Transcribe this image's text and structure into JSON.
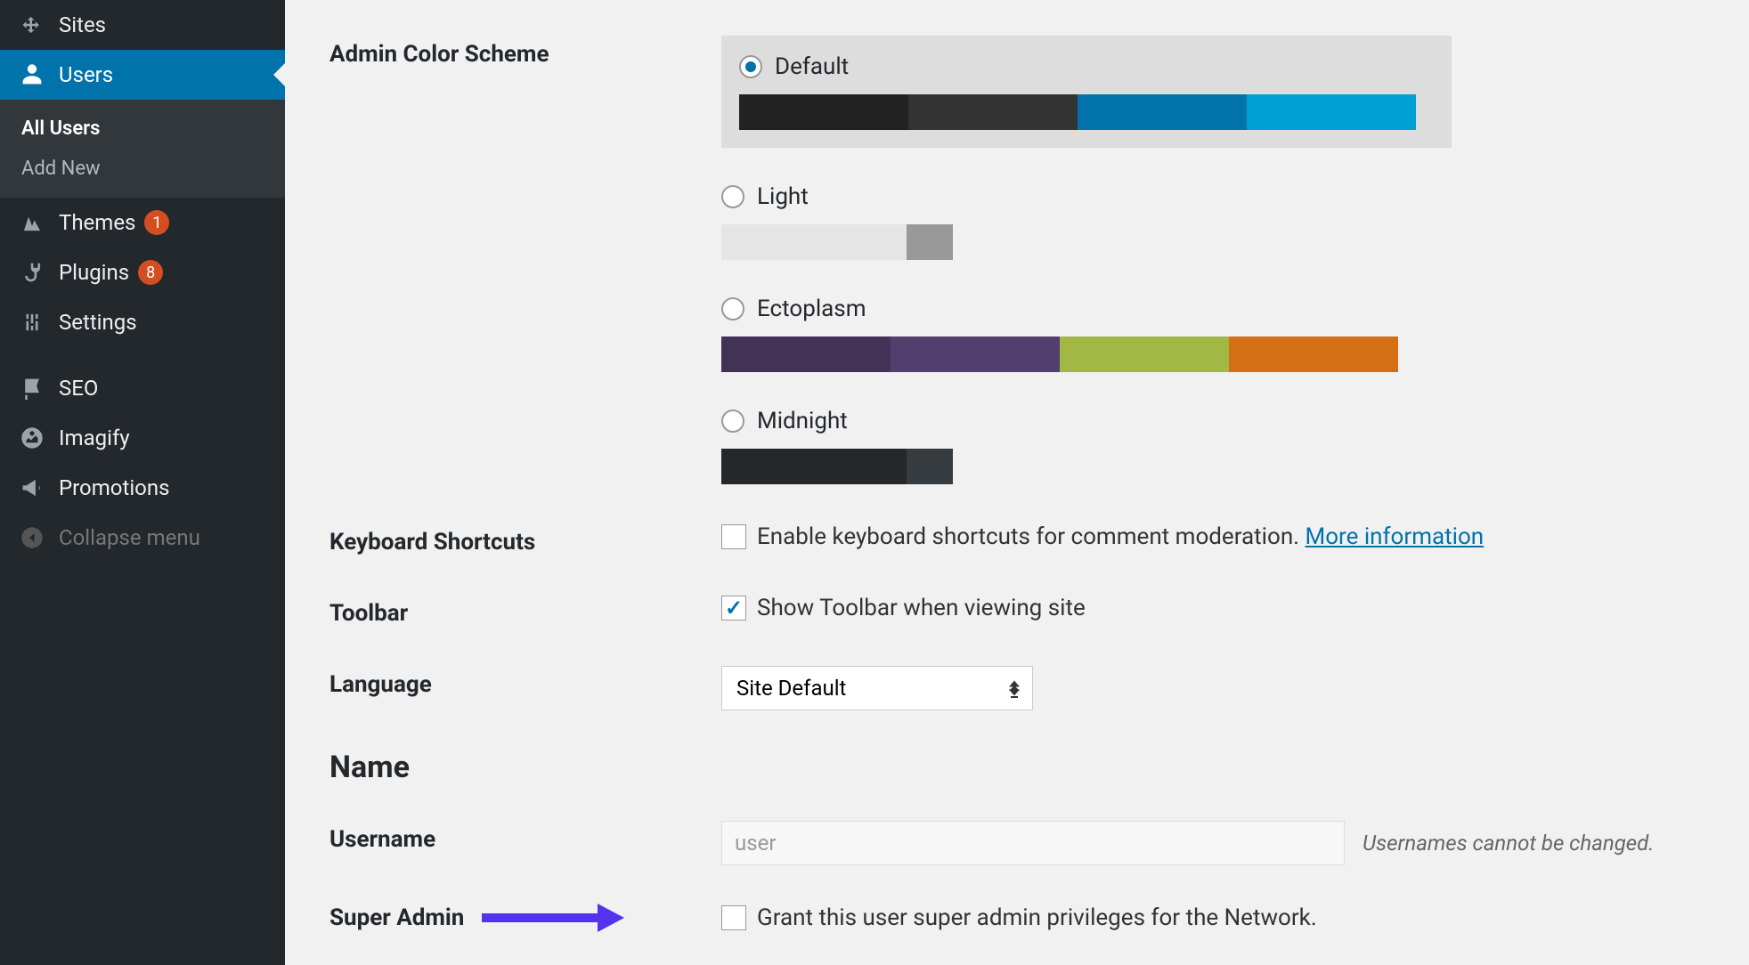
{
  "sidebar": {
    "items": [
      {
        "label": "Sites",
        "icon": "sites"
      },
      {
        "label": "Users",
        "icon": "users",
        "active": true
      },
      {
        "label": "Themes",
        "icon": "themes",
        "badge": "1"
      },
      {
        "label": "Plugins",
        "icon": "plugins",
        "badge": "8"
      },
      {
        "label": "Settings",
        "icon": "settings"
      },
      {
        "label": "SEO",
        "icon": "seo"
      },
      {
        "label": "Imagify",
        "icon": "imagify"
      },
      {
        "label": "Promotions",
        "icon": "promotions"
      },
      {
        "label": "Collapse menu",
        "icon": "collapse"
      }
    ],
    "submenu": [
      {
        "label": "All Users",
        "current": true
      },
      {
        "label": "Add New"
      }
    ]
  },
  "form": {
    "adminColorScheme": {
      "label": "Admin Color Scheme",
      "options": [
        {
          "name": "Default",
          "selected": true,
          "colors": [
            "#222",
            "#333",
            "#0073aa",
            "#00a0d2"
          ]
        },
        {
          "name": "Light",
          "colors": [
            "#e5e5e5",
            "#999",
            "#d64e07",
            "#04a4cc"
          ]
        },
        {
          "name": "Ectoplasm",
          "colors": [
            "#413256",
            "#523f6d",
            "#a3b745",
            "#d46f15"
          ]
        },
        {
          "name": "Midnight",
          "colors": [
            "#25282b",
            "#363b3f",
            "#69a8bb",
            "#e14d43"
          ]
        }
      ]
    },
    "keyboardShortcuts": {
      "label": "Keyboard Shortcuts",
      "checkboxLabel": "Enable keyboard shortcuts for comment moderation.",
      "link": "More information",
      "checked": false
    },
    "toolbar": {
      "label": "Toolbar",
      "checkboxLabel": "Show Toolbar when viewing site",
      "checked": true
    },
    "language": {
      "label": "Language",
      "value": "Site Default"
    },
    "nameSection": "Name",
    "username": {
      "label": "Username",
      "value": "user",
      "desc": "Usernames cannot be changed."
    },
    "superAdmin": {
      "label": "Super Admin",
      "checkboxLabel": "Grant this user super admin privileges for the Network.",
      "checked": false
    }
  }
}
